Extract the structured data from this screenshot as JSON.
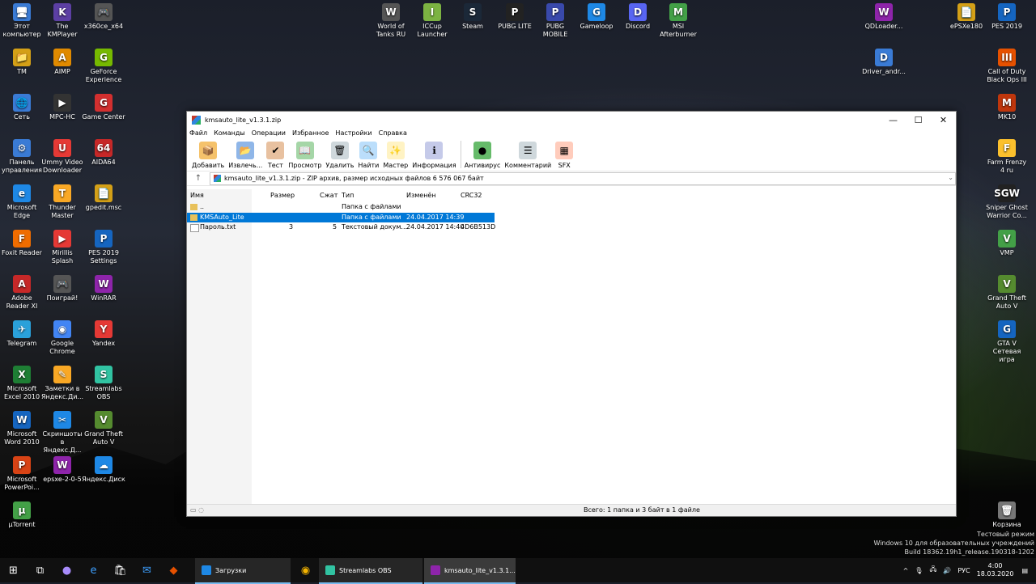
{
  "desktop": {
    "left_icons": [
      {
        "label": "Этот\nкомпьютер",
        "glyph": "🖥",
        "color": "#3a7bd5"
      },
      {
        "label": "The KMPlayer",
        "glyph": "K",
        "color": "#5c3fa3"
      },
      {
        "label": "x360ce_x64",
        "glyph": "🎮",
        "color": "#555555"
      },
      {
        "label": "TM",
        "glyph": "📁",
        "color": "#d4a017"
      },
      {
        "label": "AIMP",
        "glyph": "A",
        "color": "#e08a00"
      },
      {
        "label": "GeForce\nExperience",
        "glyph": "G",
        "color": "#76b900"
      },
      {
        "label": "Сеть",
        "glyph": "🌐",
        "color": "#3a7bd5"
      },
      {
        "label": "MPC-HC",
        "glyph": "▶",
        "color": "#333333"
      },
      {
        "label": "Game Center",
        "glyph": "G",
        "color": "#d32f2f"
      },
      {
        "label": "Панель\nуправления",
        "glyph": "⚙",
        "color": "#3a7bd5"
      },
      {
        "label": "Ummy Video\nDownloader",
        "glyph": "U",
        "color": "#e53935"
      },
      {
        "label": "AIDA64",
        "glyph": "64",
        "color": "#c62828"
      },
      {
        "label": "Microsoft\nEdge",
        "glyph": "e",
        "color": "#1e88e5"
      },
      {
        "label": "Thunder\nMaster",
        "glyph": "T",
        "color": "#f9a825"
      },
      {
        "label": "gpedit.msc",
        "glyph": "📄",
        "color": "#d4a017"
      },
      {
        "label": "Foxit Reader",
        "glyph": "F",
        "color": "#ef6c00"
      },
      {
        "label": "Mirillis Splash",
        "glyph": "▶",
        "color": "#e53935"
      },
      {
        "label": "PES 2019\nSettings",
        "glyph": "P",
        "color": "#1565c0"
      },
      {
        "label": "Adobe\nReader XI",
        "glyph": "A",
        "color": "#c62828"
      },
      {
        "label": "Поиграй!",
        "glyph": "🎮",
        "color": "#555555"
      },
      {
        "label": "WinRAR",
        "glyph": "W",
        "color": "#8e24aa"
      },
      {
        "label": "Telegram",
        "glyph": "✈",
        "color": "#2aa1da"
      },
      {
        "label": "Google\nChrome",
        "glyph": "◉",
        "color": "#4285f4"
      },
      {
        "label": "Yandex",
        "glyph": "Y",
        "color": "#e53935"
      },
      {
        "label": "Microsoft\nExcel 2010",
        "glyph": "X",
        "color": "#1e7e34"
      },
      {
        "label": "Заметки в\nЯндекс.Ди...",
        "glyph": "✎",
        "color": "#f9a825"
      },
      {
        "label": "Streamlabs\nOBS",
        "glyph": "S",
        "color": "#31c3a2"
      },
      {
        "label": "Microsoft\nWord 2010",
        "glyph": "W",
        "color": "#1565c0"
      },
      {
        "label": "Скриншоты\nв Яндекс.Д...",
        "glyph": "✂",
        "color": "#1e88e5"
      },
      {
        "label": "Grand Theft\nAuto V",
        "glyph": "V",
        "color": "#558b2f"
      },
      {
        "label": "Microsoft\nPowerPoi...",
        "glyph": "P",
        "color": "#d84315"
      },
      {
        "label": "epsxe-2-0-5",
        "glyph": "W",
        "color": "#8e24aa"
      },
      {
        "label": "Яндекс.Диск",
        "glyph": "☁",
        "color": "#1e88e5"
      },
      {
        "label": "µTorrent",
        "glyph": "µ",
        "color": "#43a047"
      }
    ],
    "top_icons": [
      {
        "label": "World of\nTanks RU",
        "glyph": "W",
        "color": "#555555"
      },
      {
        "label": "ICCup\nLauncher",
        "glyph": "I",
        "color": "#7cb342"
      },
      {
        "label": "Steam",
        "glyph": "S",
        "color": "#1b2838"
      },
      {
        "label": "PUBG LITE",
        "glyph": "P",
        "color": "#222222"
      },
      {
        "label": "PUBG\nMOBILE",
        "glyph": "P",
        "color": "#3949ab"
      },
      {
        "label": "Gameloop",
        "glyph": "G",
        "color": "#1e88e5"
      },
      {
        "label": "Discord",
        "glyph": "D",
        "color": "#5865f2"
      },
      {
        "label": "MSI\nAfterburner",
        "glyph": "M",
        "color": "#43a047"
      }
    ],
    "right_icons": [
      {
        "label": "QDLoader...",
        "glyph": "W",
        "color": "#8e24aa"
      },
      {
        "label": "ePSXe180",
        "glyph": "📄",
        "color": "#d4a017"
      },
      {
        "label": "PES 2019",
        "glyph": "P",
        "color": "#1565c0"
      },
      {
        "label": "Driver_andr...",
        "glyph": "D",
        "color": "#3a7bd5"
      },
      {
        "label": "Call of Duty\nBlack Ops III",
        "glyph": "III",
        "color": "#e65100"
      },
      {
        "label": "MK10",
        "glyph": "M",
        "color": "#bf360c"
      },
      {
        "label": "Farm Frenzy\n4 ru",
        "glyph": "F",
        "color": "#fbc02d"
      },
      {
        "label": "Sniper Ghost\nWarrior Co...",
        "glyph": "SGW",
        "color": "#222222"
      },
      {
        "label": "VMP",
        "glyph": "V",
        "color": "#43a047"
      },
      {
        "label": "Grand Theft\nAuto V",
        "glyph": "V",
        "color": "#558b2f"
      },
      {
        "label": "GTA V\nСетевая игра",
        "glyph": "G",
        "color": "#1565c0"
      },
      {
        "label": "Корзина",
        "glyph": "🗑",
        "color": "#777777"
      }
    ]
  },
  "window": {
    "title": "kmsauto_lite_v1.3.1.zip",
    "controls": {
      "minimize": "—",
      "maximize": "☐",
      "close": "✕"
    },
    "menu": [
      "Файл",
      "Команды",
      "Операции",
      "Избранное",
      "Настройки",
      "Справка"
    ],
    "toolbar": [
      {
        "label": "Добавить",
        "glyph": "📦",
        "color": "#f5c26b"
      },
      {
        "label": "Извлечь...",
        "glyph": "📂",
        "color": "#8fb6e8"
      },
      {
        "label": "Тест",
        "glyph": "✔",
        "color": "#e8c1a0"
      },
      {
        "label": "Просмотр",
        "glyph": "📖",
        "color": "#a5d6a7"
      },
      {
        "label": "Удалить",
        "glyph": "🗑",
        "color": "#cfd8dc"
      },
      {
        "label": "Найти",
        "glyph": "🔍",
        "color": "#bbdefb"
      },
      {
        "label": "Мастер",
        "glyph": "✨",
        "color": "#fff3c4"
      },
      {
        "label": "Информация",
        "glyph": "ℹ",
        "color": "#c5cae9"
      },
      {
        "label": "Антивирус",
        "glyph": "●",
        "color": "#66bb6a"
      },
      {
        "label": "Комментарий",
        "glyph": "☰",
        "color": "#cfd8dc"
      },
      {
        "label": "SFX",
        "glyph": "▦",
        "color": "#ffccbc"
      }
    ],
    "path": "kmsauto_lite_v1.3.1.zip - ZIP архив, размер исходных файлов 6 576 067 байт",
    "columns": {
      "name": "Имя",
      "size": "Размер",
      "packed": "Сжат",
      "type": "Тип",
      "modified": "Изменён",
      "crc": "CRC32"
    },
    "rows": [
      {
        "name": "..",
        "size": "",
        "packed": "",
        "type": "Папка с файлами",
        "modified": "",
        "crc": "",
        "selected": false,
        "kind": "folder"
      },
      {
        "name": "KMSAuto_Lite",
        "size": "",
        "packed": "",
        "type": "Папка с файлами",
        "modified": "24.04.2017 14:39",
        "crc": "",
        "selected": true,
        "kind": "folder"
      },
      {
        "name": "Пароль.txt",
        "size": "3",
        "packed": "5",
        "type": "Текстовый докум...",
        "modified": "24.04.2017 14:40",
        "crc": "4D6B513D",
        "selected": false,
        "kind": "file"
      }
    ],
    "status": "Всего: 1 папка и 3 байт в 1 файле"
  },
  "taskbar": {
    "tasks": [
      {
        "label": "Загрузки",
        "color": "#1e88e5"
      },
      {
        "label": "Streamlabs OBS",
        "color": "#31c3a2"
      },
      {
        "label": "kmsauto_lite_v1.3.1...",
        "color": "#8e24aa"
      }
    ],
    "language": "РУС",
    "time": "4:00",
    "date": "18.03.2020"
  },
  "watermark": {
    "line1": "Тестовый режим",
    "line2": "Windows 10 для образовательных учреждений",
    "line3": "Build 18362.19h1_release.190318-1202"
  }
}
